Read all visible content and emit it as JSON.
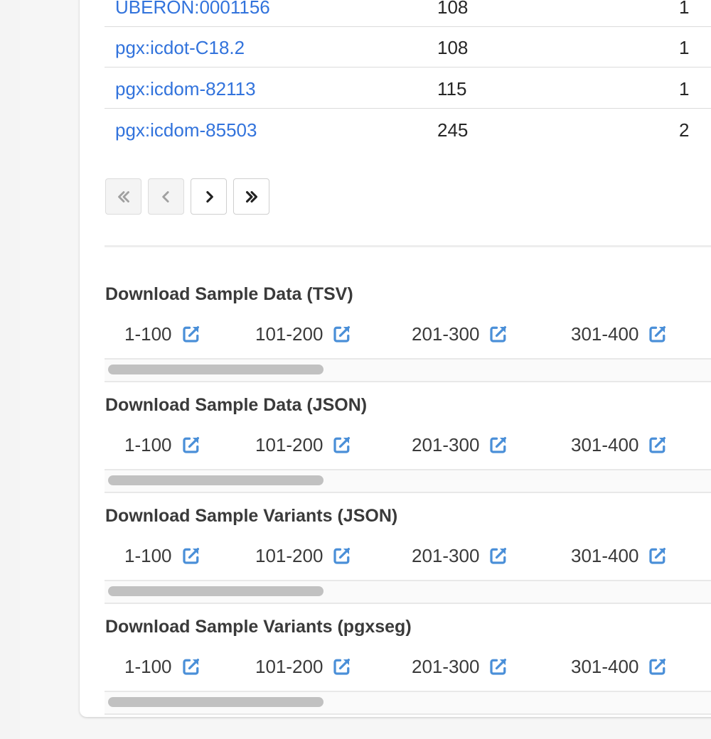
{
  "table": {
    "rows": [
      {
        "id": "UBERON:0001156",
        "count": "108",
        "pct": "1"
      },
      {
        "id": "pgx:icdot-C18.2",
        "count": "108",
        "pct": "1"
      },
      {
        "id": "pgx:icdom-82113",
        "count": "115",
        "pct": "1"
      },
      {
        "id": "pgx:icdom-85503",
        "count": "245",
        "pct": "2"
      }
    ]
  },
  "pagination": {
    "icons": [
      "double-chevron-left-icon",
      "chevron-left-icon",
      "chevron-right-icon",
      "double-chevron-right-icon"
    ]
  },
  "downloads": [
    {
      "title": "Download Sample Data (TSV)",
      "ranges": [
        "1-100",
        "101-200",
        "201-300",
        "301-400"
      ]
    },
    {
      "title": "Download Sample Data (JSON)",
      "ranges": [
        "1-100",
        "101-200",
        "201-300",
        "301-400"
      ]
    },
    {
      "title": "Download Sample Variants (JSON)",
      "ranges": [
        "1-100",
        "101-200",
        "201-300",
        "301-400"
      ]
    },
    {
      "title": "Download Sample Variants (pgxseg)",
      "ranges": [
        "1-100",
        "101-200",
        "201-300",
        "301-400"
      ]
    }
  ],
  "colors": {
    "link": "#3273dc",
    "icon": "#4a8fd8",
    "panel": "#ffffff",
    "background": "#f6f6f6"
  }
}
